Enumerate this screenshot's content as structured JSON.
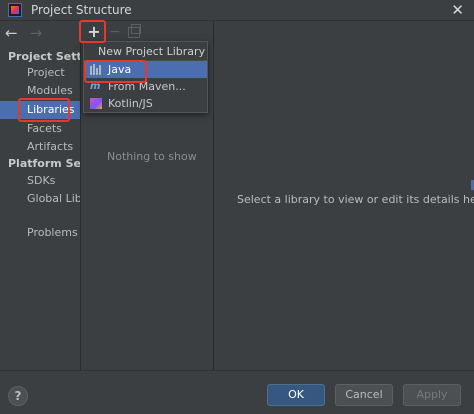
{
  "window": {
    "title": "Project Structure",
    "close_glyph": "✕"
  },
  "nav": {
    "back_glyph": "←",
    "forward_glyph": "→"
  },
  "sidebar": {
    "project_settings_header": "Project Settings",
    "project_items": [
      {
        "label": "Project"
      },
      {
        "label": "Modules"
      },
      {
        "label": "Libraries",
        "selected": true
      },
      {
        "label": "Facets"
      },
      {
        "label": "Artifacts"
      }
    ],
    "platform_settings_header": "Platform Settings",
    "platform_items": [
      {
        "label": "SDKs"
      },
      {
        "label": "Global Libraries"
      }
    ],
    "problems_label": "Problems"
  },
  "toolbar": {
    "add_glyph": "+",
    "remove_glyph": "−"
  },
  "libraries_panel": {
    "empty_text": "Nothing to show"
  },
  "popup": {
    "header": "New Project Library",
    "items": [
      {
        "label": "Java",
        "icon": "java-library-icon",
        "selected": true
      },
      {
        "label": "From Maven...",
        "icon": "maven-icon"
      },
      {
        "label": "Kotlin/JS",
        "icon": "kotlin-js-icon"
      }
    ]
  },
  "details_panel": {
    "placeholder": "Select a library to view or edit its details here"
  },
  "footer": {
    "help_glyph": "?",
    "ok_label": "OK",
    "cancel_label": "Cancel",
    "apply_label": "Apply"
  },
  "colors": {
    "accent": "#4b6eaf",
    "annotation": "#e8382c",
    "background": "#3c3f41"
  }
}
